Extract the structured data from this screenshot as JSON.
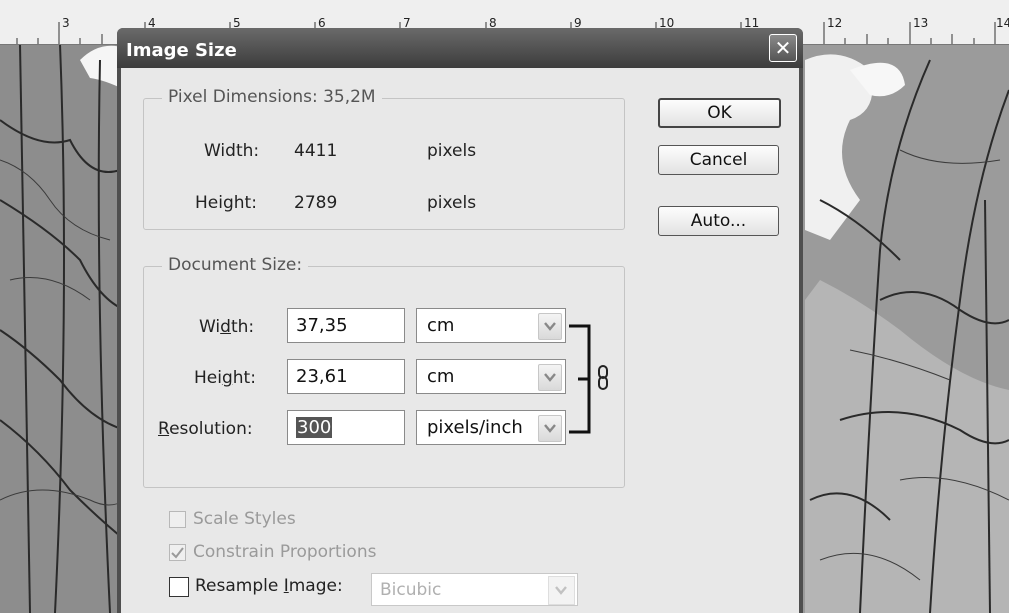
{
  "ruler": {
    "numbers": [
      "3",
      "4",
      "5",
      "6",
      "7",
      "8",
      "9",
      "10",
      "11",
      "12",
      "13",
      "14"
    ]
  },
  "dialog": {
    "title": "Image Size",
    "close_icon": "close-icon",
    "pixel_dimensions": {
      "legend": "Pixel Dimensions:  35,2M",
      "width_label": "Width:",
      "width_value": "4411",
      "width_unit": "pixels",
      "height_label": "Height:",
      "height_value": "2789",
      "height_unit": "pixels"
    },
    "document_size": {
      "legend": "Document Size:",
      "width_label": "Width:",
      "width_value": "37,35",
      "width_unit": "cm",
      "height_label": "Height:",
      "height_value": "23,61",
      "height_unit": "cm",
      "resolution_label": "Resolution:",
      "resolution_value": "300",
      "resolution_unit": "pixels/inch",
      "link_icon": "chain-link-icon"
    },
    "buttons": {
      "ok": "OK",
      "cancel": "Cancel",
      "auto": "Auto..."
    },
    "options": {
      "scale_styles": {
        "label": "Scale Styles",
        "checked": false,
        "enabled": false
      },
      "constrain_proportions": {
        "label": "Constrain Proportions",
        "checked": true,
        "enabled": false
      },
      "resample_image": {
        "label": "Resample Image:",
        "checked": false,
        "enabled": true
      },
      "resample_method": "Bicubic"
    }
  }
}
